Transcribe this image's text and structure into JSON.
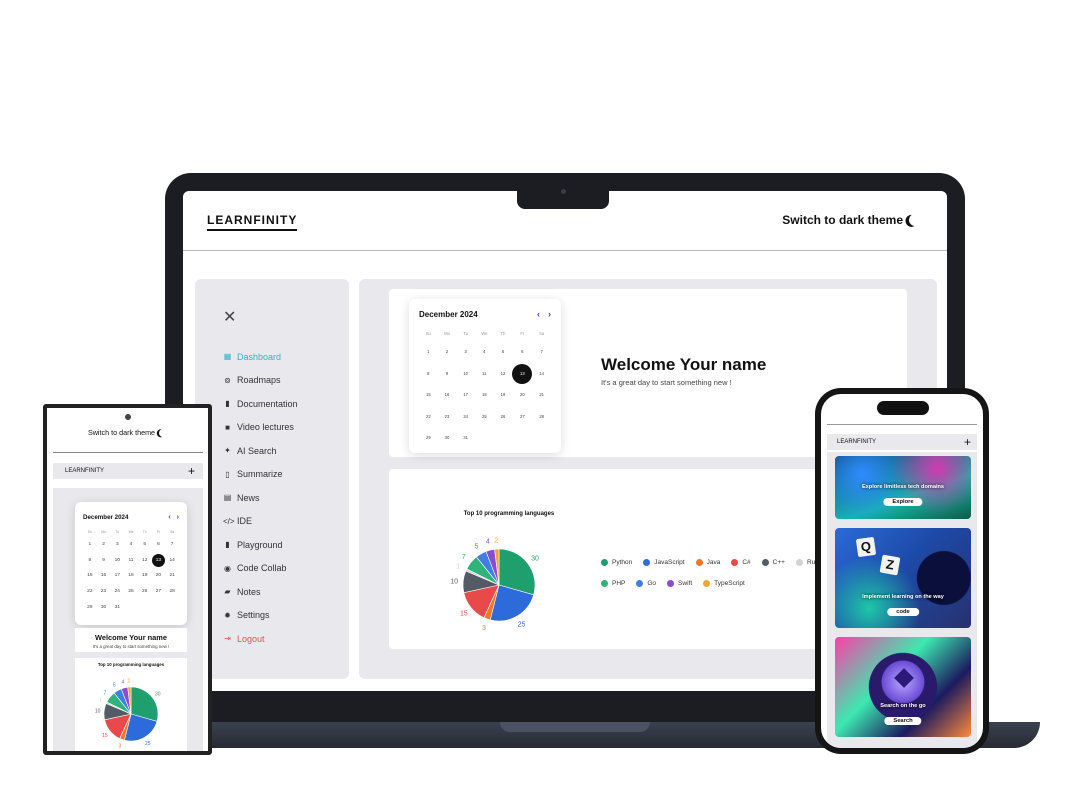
{
  "laptop": {
    "brand": "LEARNFINITY",
    "theme_toggle": "Switch to dark theme",
    "sidebar": {
      "items": [
        {
          "label": "Dashboard",
          "icon": "grid-icon",
          "glyph": "▦"
        },
        {
          "label": "Roadmaps",
          "icon": "map-icon",
          "glyph": "⊚"
        },
        {
          "label": "Documentation",
          "icon": "document-icon",
          "glyph": "▮"
        },
        {
          "label": "Video lectures",
          "icon": "video-icon",
          "glyph": "■"
        },
        {
          "label": "AI Search",
          "icon": "sparkle-icon",
          "glyph": "✦"
        },
        {
          "label": "Summarize",
          "icon": "phone-icon",
          "glyph": "▯"
        },
        {
          "label": "News",
          "icon": "news-icon",
          "glyph": "▤"
        },
        {
          "label": "IDE",
          "icon": "code-icon",
          "glyph": "</>"
        },
        {
          "label": "Playground",
          "icon": "file-icon",
          "glyph": "▮"
        },
        {
          "label": "Code Collab",
          "icon": "eye-icon",
          "glyph": "◉"
        },
        {
          "label": "Notes",
          "icon": "chat-icon",
          "glyph": "▰"
        },
        {
          "label": "Settings",
          "icon": "gear-icon",
          "glyph": "✹"
        },
        {
          "label": "Logout",
          "icon": "logout-icon",
          "glyph": "⇥"
        }
      ],
      "active": "Dashboard"
    },
    "welcome": {
      "title": "Welcome Your name",
      "subtitle": "It's a great day to start something new !"
    },
    "chart_title": "Top 10 programming languages",
    "legend_row1": [
      "Python",
      "JavaScript",
      "Java",
      "C#",
      "C++",
      "Ruby"
    ],
    "legend_row2": [
      "PHP",
      "Go",
      "Swift",
      "TypeScript"
    ]
  },
  "calendar": {
    "month": "December 2024",
    "weekdays": [
      "Su",
      "Mo",
      "Tu",
      "We",
      "Th",
      "Fr",
      "Sa"
    ],
    "days": [
      1,
      2,
      3,
      4,
      5,
      6,
      7,
      8,
      9,
      10,
      11,
      12,
      13,
      14,
      15,
      16,
      17,
      18,
      19,
      20,
      21,
      22,
      23,
      24,
      25,
      26,
      27,
      28,
      29,
      30,
      31
    ],
    "selected": 13
  },
  "phone_left": {
    "theme_toggle": "Switch to dark theme",
    "brand": "LEARNFINITY",
    "plus": "+",
    "welcome": {
      "title": "Welcome Your name",
      "subtitle": "It's a great day to start something new !"
    },
    "chart_title": "Top 10 programming languages"
  },
  "phone_right": {
    "brand": "LEARNFINITY",
    "plus": "+",
    "cards": [
      {
        "caption": "Explore limitless tech domains",
        "button": "Explore"
      },
      {
        "caption": "Implement learning on the way",
        "button": "code",
        "tiles": [
          "Q",
          "Z"
        ]
      },
      {
        "caption": "Search on the go",
        "button": "Search"
      }
    ]
  },
  "colors": {
    "accent": "#28b5c6",
    "logout": "#e05252",
    "nav_arrow": "#3b3bd6"
  },
  "chart_data": {
    "type": "pie",
    "title": "Top 10 programming languages",
    "categories": [
      "Python",
      "JavaScript",
      "Java",
      "C#",
      "C++",
      "Ruby",
      "PHP",
      "Go",
      "Swift",
      "TypeScript"
    ],
    "values": [
      30,
      25,
      3,
      15,
      10,
      1,
      7,
      5,
      4,
      2
    ],
    "colors": [
      "#1f9e6e",
      "#2d6bdb",
      "#f0772a",
      "#e84a4a",
      "#555b66",
      "#d0d3d8",
      "#2fb37a",
      "#3f7fe0",
      "#8a4bd6",
      "#f2a531"
    ],
    "value_labels": [
      "30",
      "25",
      "3",
      "15",
      "10",
      "1",
      "7",
      "5",
      "4",
      "2"
    ],
    "legend_position": "right"
  }
}
